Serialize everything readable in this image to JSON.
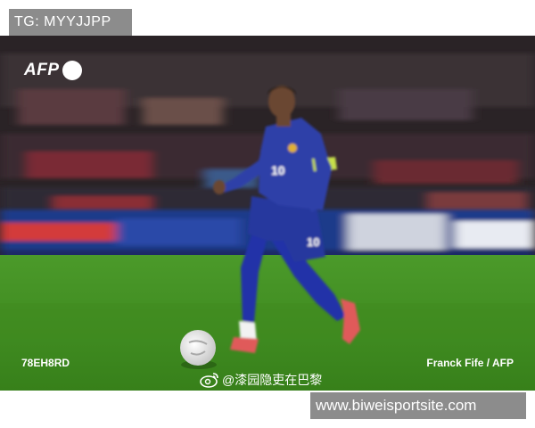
{
  "watermark_top": "TG: MYYJJPP",
  "photo": {
    "agency_logo": "AFP",
    "photo_code": "78EH8RD",
    "credit": "Franck Fife / AFP",
    "weibo_handle": "@漆园隐吏在巴黎",
    "jersey_number": "10",
    "colors": {
      "pitch": "#3f8a1e",
      "jersey": "#2d3fa8",
      "stands": "#2a2326"
    }
  },
  "watermark_bottom": "www.biweisportsite.com"
}
